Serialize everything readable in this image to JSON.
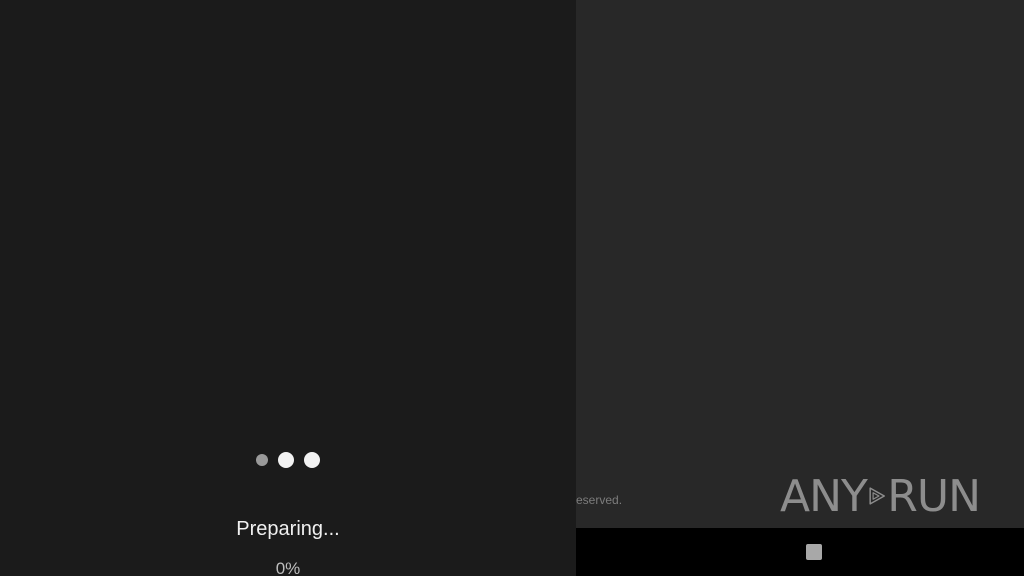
{
  "loader": {
    "status_text": "Preparing...",
    "progress_text": "0%",
    "progress_value": 0
  },
  "footer": {
    "copyright_fragment": "eserved."
  },
  "watermark": {
    "left_text": "ANY",
    "right_text": "RUN",
    "icon": "play-triangle-icon"
  },
  "navigation_bar": {
    "stop_icon": "stop-square-icon"
  },
  "colors": {
    "left_background": "#1b1b1b",
    "right_background": "#282828",
    "bottom_bar": "#000000",
    "dot_light": "#f2f2f2",
    "dot_dim": "#9a9a9a"
  }
}
